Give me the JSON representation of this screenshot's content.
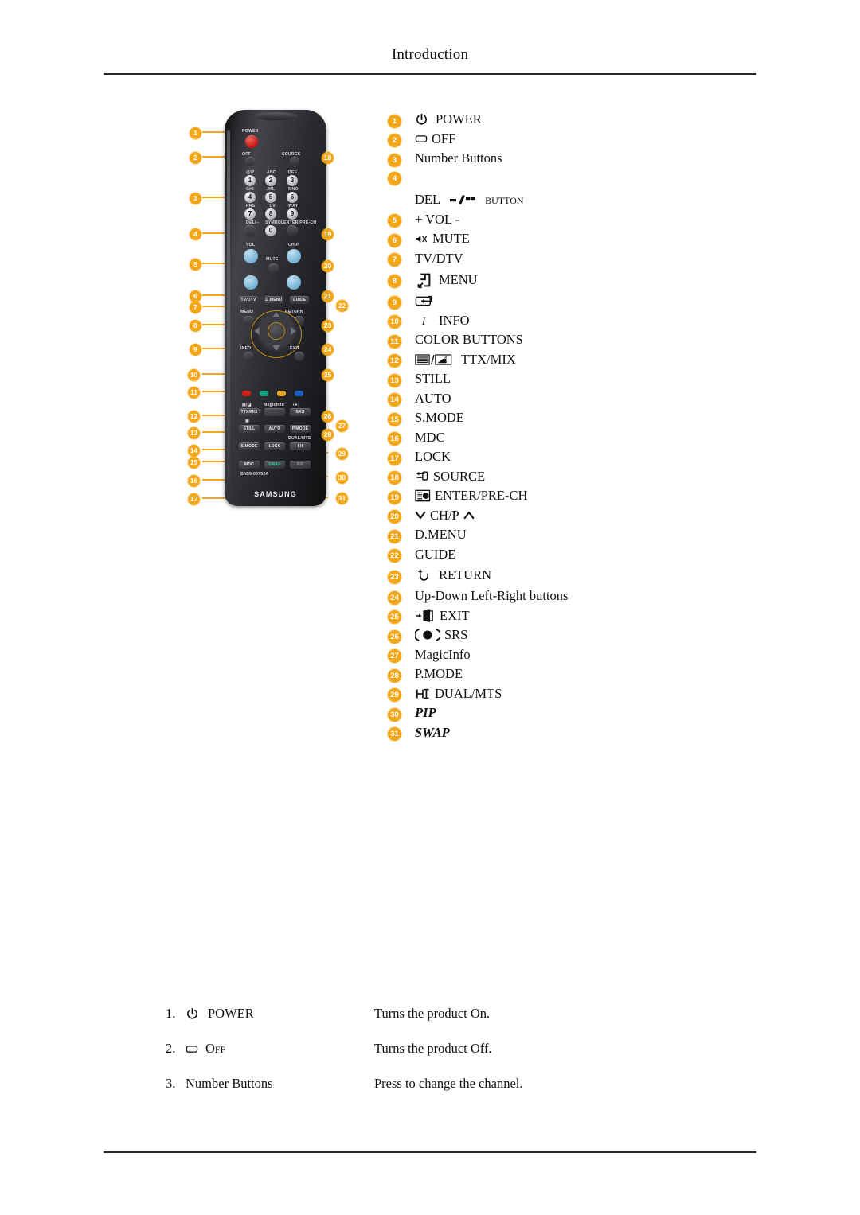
{
  "header": {
    "title": "Introduction"
  },
  "figure": {
    "alt_name": "samsung-remote-control-diagram",
    "brand": "SAMSUNG",
    "model_code": "BN59-00752A",
    "labels": {
      "power": "POWER",
      "off": "OFF",
      "source": "SOURCE",
      "vol": "VOL",
      "mute": "MUTE",
      "chp": "CH/P",
      "tvdtv": "TV/DTV",
      "dmenu": "D.MENU",
      "guide": "GUIDE",
      "menu": "MENU",
      "return": "RETURN",
      "info": "INFO",
      "exit": "EXIT",
      "magicinfo": "MagicInfo",
      "srs": "SRS",
      "ttxmix": "TTX/MIX",
      "still": "STILL",
      "auto": "AUTO",
      "pmode": "P.MODE",
      "smode": "S.MODE",
      "lock": "LOCK",
      "dualmts": "DUAL/MTS",
      "dualmts_glyph": "I-II",
      "mdc": "MDC",
      "swap": "SWAP",
      "pip": "PIP"
    },
    "keypad": {
      "rows": [
        [
          {
            "num": "1",
            "sub": "@!?"
          },
          {
            "num": "2",
            "sub": "ABC"
          },
          {
            "num": "3",
            "sub": "DEF"
          }
        ],
        [
          {
            "num": "4",
            "sub": "GHI"
          },
          {
            "num": "5",
            "sub": "JKL"
          },
          {
            "num": "6",
            "sub": "MNO"
          }
        ],
        [
          {
            "num": "7",
            "sub": "PRS"
          },
          {
            "num": "8",
            "sub": "TUV"
          },
          {
            "num": "9",
            "sub": "WXY"
          }
        ]
      ],
      "bottom": [
        {
          "num": "DEL",
          "sub": "DEL/--"
        },
        {
          "num": "0",
          "sub": "SYMBOL"
        },
        {
          "num": "ENTER",
          "sub": "ENTER/PRE-CH"
        }
      ]
    },
    "color_buttons": [
      "#d2201d",
      "#12a07c",
      "#e5a627",
      "#1f5fc4"
    ],
    "callout_numbers_left": [
      "1",
      "2",
      "3",
      "4",
      "5",
      "6",
      "7",
      "8",
      "9",
      "10",
      "11",
      "12",
      "13",
      "14",
      "15",
      "16",
      "17"
    ],
    "callout_numbers_right": [
      "18",
      "19",
      "20",
      "21",
      "22",
      "23",
      "24",
      "25",
      "26",
      "27",
      "28",
      "29",
      "30",
      "31"
    ]
  },
  "legend": {
    "items": [
      {
        "n": "1",
        "icon": "power-icon",
        "text": "POWER",
        "style": "caps"
      },
      {
        "n": "2",
        "icon": "standby-icon",
        "text": "OFF",
        "style": "caps"
      },
      {
        "n": "3",
        "icon": "",
        "text": "Number Buttons",
        "style": ""
      },
      {
        "n": "4",
        "icon": "del-dash-icon",
        "text": "DEL",
        "suffix": "button",
        "style": "caps-tall"
      },
      {
        "n": "5",
        "icon": "",
        "text": "+ VOL -",
        "style": "caps"
      },
      {
        "n": "6",
        "icon": "mute-icon",
        "text": "MUTE",
        "style": "caps"
      },
      {
        "n": "7",
        "icon": "",
        "text": "TV/DTV",
        "style": "caps"
      },
      {
        "n": "8",
        "icon": "menu-icon",
        "text": "MENU",
        "style": "caps"
      },
      {
        "n": "9",
        "icon": "enter-box-icon",
        "text": "",
        "style": ""
      },
      {
        "n": "10",
        "icon": "info-i-icon",
        "text": "INFO",
        "style": "caps"
      },
      {
        "n": "11",
        "icon": "",
        "text": "COLOR BUTTONS",
        "style": "caps"
      },
      {
        "n": "12",
        "icon": "ttx-mix-icon",
        "text": "TTX/MIX",
        "style": "caps"
      },
      {
        "n": "13",
        "icon": "",
        "text": "STILL",
        "style": "caps"
      },
      {
        "n": "14",
        "icon": "",
        "text": "AUTO",
        "style": "caps"
      },
      {
        "n": "15",
        "icon": "",
        "text": "S.MODE",
        "style": "caps"
      },
      {
        "n": "16",
        "icon": "",
        "text": "MDC",
        "style": "caps"
      },
      {
        "n": "17",
        "icon": "",
        "text": "LOCK",
        "style": "caps"
      },
      {
        "n": "18",
        "icon": "source-icon",
        "text": "SOURCE",
        "style": "caps"
      },
      {
        "n": "19",
        "icon": "enter-prech-icon",
        "text": "ENTER/PRE-CH",
        "style": "caps"
      },
      {
        "n": "20",
        "icon": "chp-arrows-icon",
        "text": "CH/P",
        "style": "caps"
      },
      {
        "n": "21",
        "icon": "",
        "text": "D.MENU",
        "style": "caps"
      },
      {
        "n": "22",
        "icon": "",
        "text": "GUIDE",
        "style": "caps"
      },
      {
        "n": "23",
        "icon": "return-arrow-icon",
        "text": "RETURN",
        "style": "caps"
      },
      {
        "n": "24",
        "icon": "",
        "text": "Up-Down Left-Right buttons",
        "style": ""
      },
      {
        "n": "25",
        "icon": "exit-door-icon",
        "text": "EXIT",
        "style": "caps"
      },
      {
        "n": "26",
        "icon": "srs-icon",
        "text": "SRS",
        "style": "caps"
      },
      {
        "n": "27",
        "icon": "",
        "text": "MagicInfo",
        "style": ""
      },
      {
        "n": "28",
        "icon": "",
        "text": "P.MODE",
        "style": "caps"
      },
      {
        "n": "29",
        "icon": "dual-mts-icon",
        "text": "DUAL/MTS",
        "style": "caps"
      },
      {
        "n": "30",
        "icon": "",
        "text": "PIP",
        "style": "ital"
      },
      {
        "n": "31",
        "icon": "",
        "text": "SWAP",
        "style": "ital"
      }
    ]
  },
  "descriptions": {
    "rows": [
      {
        "index": "1.",
        "icon": "power-icon",
        "label": "POWER",
        "value": "Turns the product On."
      },
      {
        "index": "2.",
        "icon": "standby-icon",
        "label": "Off",
        "value": "Turns the product Off."
      },
      {
        "index": "3.",
        "icon": "",
        "label": "Number Buttons",
        "value": "Press to change the channel."
      }
    ]
  },
  "colors": {
    "badge": "#F2A71B",
    "rule": "#2b2b2b",
    "page_bg": "#ffffff"
  }
}
